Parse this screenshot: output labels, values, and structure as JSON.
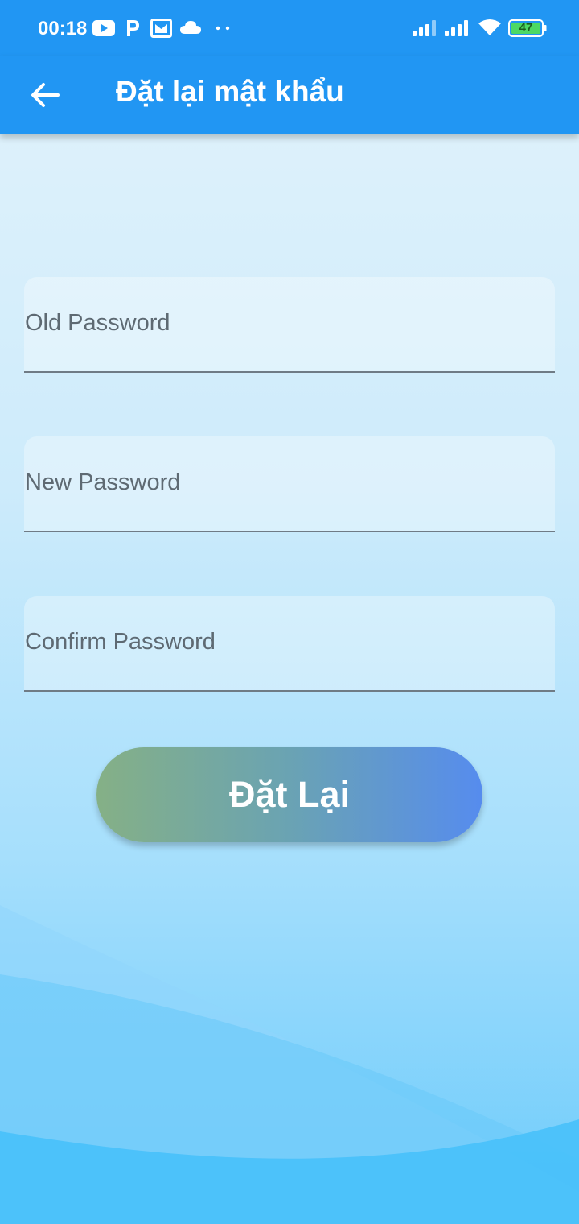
{
  "status_bar": {
    "time": "00:18",
    "battery": "47",
    "icons": [
      "youtube-icon",
      "p-app-icon",
      "mail-icon",
      "cloud-icon",
      "more-dots-icon",
      "signal-icon",
      "signal-icon",
      "wifi-icon",
      "battery-icon"
    ]
  },
  "app_bar": {
    "title": "Đặt lại mật khẩu",
    "back_icon": "arrow-left-icon"
  },
  "form": {
    "old_password": {
      "placeholder": "Old Password",
      "value": ""
    },
    "new_password": {
      "placeholder": "New Password",
      "value": ""
    },
    "confirm_password": {
      "placeholder": "Confirm Password",
      "value": ""
    },
    "submit_label": "Đặt Lại"
  },
  "colors": {
    "app_bar": "#2196f3",
    "button_gradient_start": "#85b086",
    "button_gradient_end": "#568cee",
    "battery_fill": "#4cd964"
  }
}
